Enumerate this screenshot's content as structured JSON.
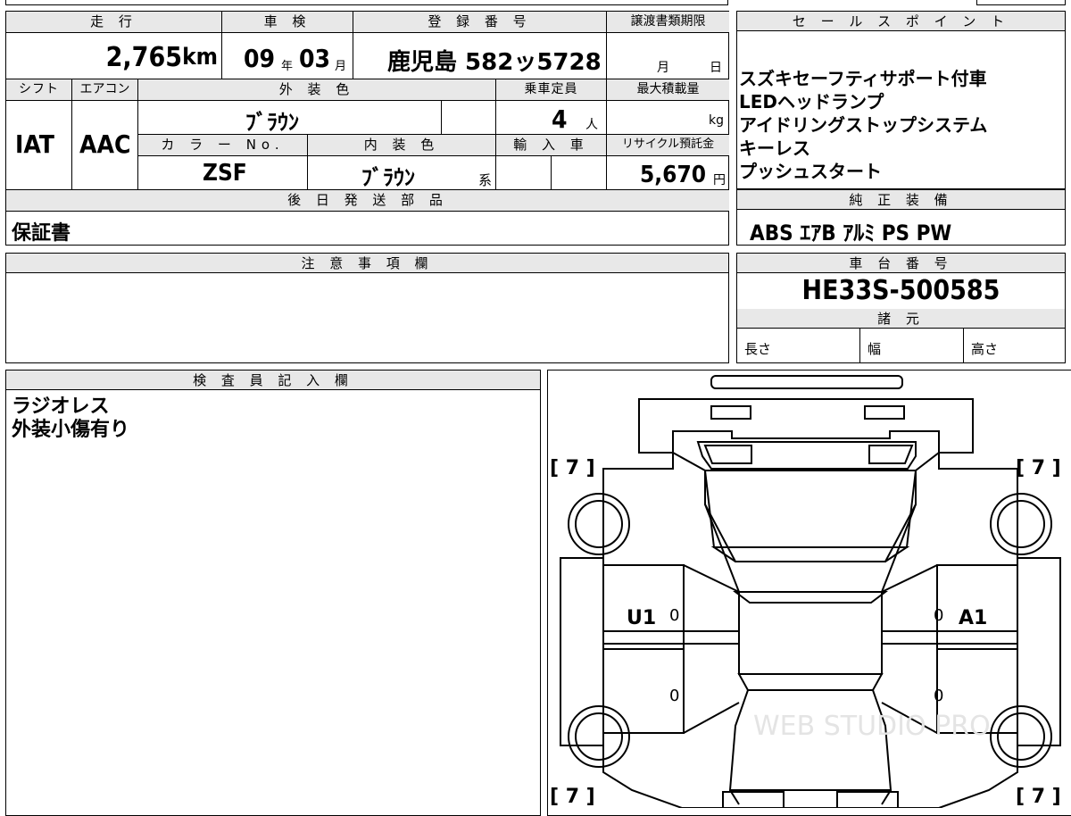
{
  "main": {
    "headers": {
      "mileage": "走 行",
      "inspection": "車 検",
      "registration": "登 録 番 号",
      "transfer_deadline": "譲渡書類期限",
      "shift": "シフト",
      "aircon": "エアコン",
      "exterior_color": "外 装 色",
      "capacity": "乗車定員",
      "max_load": "最大積載量",
      "color_no": "カ ラ ー No.",
      "interior_color": "内 装 色",
      "import": "輸 入 車",
      "recycle_fee": "リサイクル預託金",
      "later_parts": "後 日 発 送 部 品"
    },
    "mileage_value": "2,765",
    "mileage_unit": "km",
    "inspection_year": "09",
    "inspection_year_unit": "年",
    "inspection_month": "03",
    "inspection_month_unit": "月",
    "registration_value": "鹿児島 582ッ5728",
    "transfer_month_unit": "月",
    "transfer_day_unit": "日",
    "shift_value": "IAT",
    "aircon_value": "AAC",
    "exterior_color_value": "ﾌﾞﾗｳﾝ",
    "capacity_value": "4",
    "capacity_unit": "人",
    "max_load_unit": "kg",
    "color_no_value": "ZSF",
    "interior_color_value": "ﾌﾞﾗｳﾝ",
    "interior_color_suffix": "系",
    "recycle_fee_value": "5,670",
    "recycle_fee_unit": "円",
    "later_parts_value": "保証書"
  },
  "sales_points": {
    "header": "セ ー ル ス ポ イ ン ト",
    "items": [
      "スズキセーフティサポート付車",
      "LEDヘッドランプ",
      "アイドリングストップシステム",
      "キーレス",
      "プッシュスタート"
    ]
  },
  "equipment": {
    "header": "純 正 装 備",
    "value": "ABS ｴｱB ｱﾙﾐ PS PW"
  },
  "notes": {
    "header": "注 意 事 項 欄"
  },
  "chassis": {
    "header": "車 台 番 号",
    "value": "HE33S-500585",
    "specs_header": "諸 元",
    "length_label": "長さ",
    "width_label": "幅",
    "height_label": "高さ"
  },
  "inspector": {
    "header": "検 査 員 記 入 欄",
    "lines": [
      "ラジオレス",
      "外装小傷有り"
    ]
  },
  "diagram": {
    "tire_fl": "[ 7 ]",
    "tire_fr": "[ 7 ]",
    "tire_rl": "[ 7 ]",
    "tire_rr": "[ 7 ]",
    "mark_left_front_door": "U1",
    "mark_right_front_door": "A1",
    "zero": "0",
    "watermark": "WEB STUDIO PRO"
  }
}
